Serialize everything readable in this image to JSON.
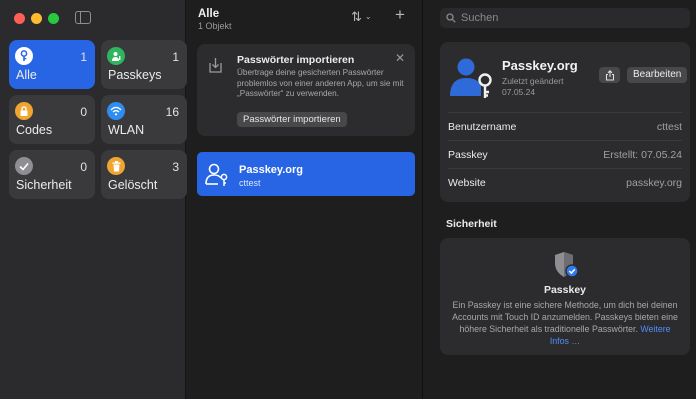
{
  "colors": {
    "accent": "#2765e5",
    "traffic_red": "#fe5f57",
    "traffic_yellow": "#febc2e",
    "traffic_green": "#28c840",
    "tile_passkeys": "#2fb55f",
    "tile_codes": "#f0a531",
    "tile_wlan": "#2f8cf0",
    "tile_security": "#8e8e93",
    "tile_deleted": "#f0a531",
    "link": "#4f8ef7"
  },
  "sidebar": {
    "tiles": [
      {
        "label": "Alle",
        "count": "1",
        "icon": "key-icon"
      },
      {
        "label": "Passkeys",
        "count": "1",
        "icon": "person-key-icon"
      },
      {
        "label": "Codes",
        "count": "0",
        "icon": "lock-code-icon"
      },
      {
        "label": "WLAN",
        "count": "16",
        "icon": "wifi-icon"
      },
      {
        "label": "Sicherheit",
        "count": "0",
        "icon": "checkmark-icon"
      },
      {
        "label": "Gelöscht",
        "count": "3",
        "icon": "trash-icon"
      }
    ]
  },
  "list": {
    "title": "Alle",
    "subtitle": "1 Objekt",
    "import": {
      "title": "Passwörter importieren",
      "text": "Übertrage deine gesicherten Passwörter problemlos von einer anderen App, um sie mit „Passwörter“ zu verwenden.",
      "button": "Passwörter importieren"
    },
    "entries": [
      {
        "title": "Passkey.org",
        "user": "cttest"
      }
    ]
  },
  "detail": {
    "search_placeholder": "Suchen",
    "title": "Passkey.org",
    "subtitle": "Zuletzt geändert 07.05.24",
    "edit_button": "Bearbeiten",
    "fields": [
      {
        "label": "Benutzername",
        "value": "cttest"
      },
      {
        "label": "Passkey",
        "value": "Erstellt: 07.05.24"
      },
      {
        "label": "Website",
        "value": "passkey.org"
      }
    ],
    "security": {
      "section_title": "Sicherheit",
      "card_title": "Passkey",
      "text": "Ein Passkey ist eine sichere Methode, um dich bei deinen Accounts mit Touch ID anzumelden. Passkeys bieten eine höhere Sicherheit als traditionelle Passwörter.",
      "link": "Weitere Infos …"
    }
  }
}
